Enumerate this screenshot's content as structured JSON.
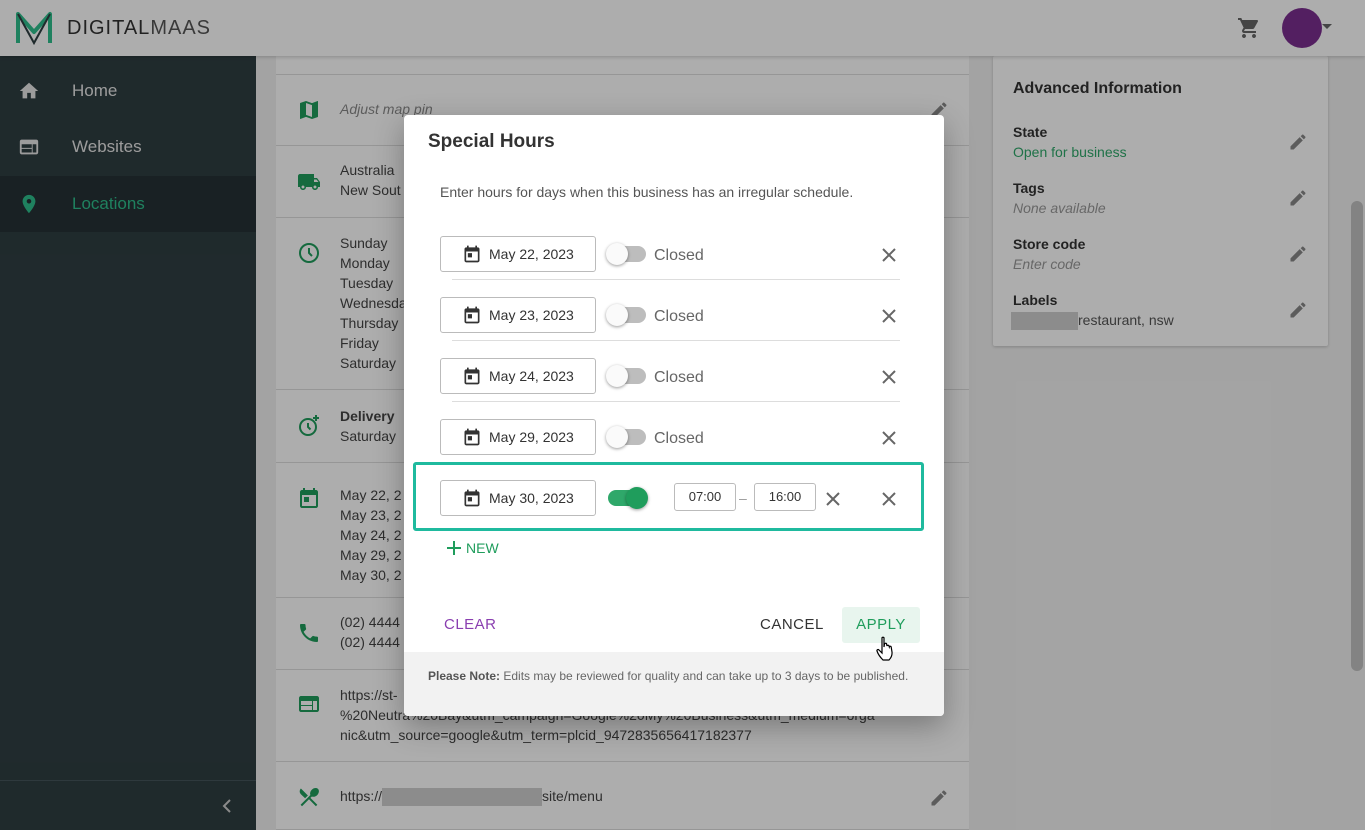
{
  "app": {
    "logo_bold": "DIGITAL",
    "logo_light": "MAAS",
    "brand_color": "#2fbf8c"
  },
  "sidebar": {
    "items": [
      {
        "label": "Home",
        "icon": "home-icon"
      },
      {
        "label": "Websites",
        "icon": "web-icon"
      },
      {
        "label": "Locations",
        "icon": "location-pin-icon"
      }
    ]
  },
  "main": {
    "map_pin": "Adjust map pin",
    "service_area_1": "Australia",
    "service_area_2": "New Sout",
    "days": [
      "Sunday",
      "Monday",
      "Tuesday",
      "Wednesday",
      "Thursday",
      "Friday",
      "Saturday"
    ],
    "delivery_label": "Delivery",
    "delivery_day": "Saturday",
    "special_dates": [
      "May 22, 2",
      "May 23, 2",
      "May 24, 2",
      "May 29, 2",
      "May 30, 2"
    ],
    "phones": [
      "(02) 4444",
      "(02) 4444"
    ],
    "url_line1": "https://st-",
    "url_line2": "%20Neutra%20Bay&utm_campaign=Google%20My%20Business&utm_medium=orga",
    "url_line3": "nic&utm_source=google&utm_term=plcid_9472835656417182377",
    "menu_prefix": "https://",
    "menu_suffix": "site/menu"
  },
  "advanced": {
    "title": "Advanced Information",
    "state_label": "State",
    "state_value": "Open for business",
    "tags_label": "Tags",
    "tags_value": "None available",
    "store_label": "Store code",
    "store_value": "Enter code",
    "labels_label": "Labels",
    "labels_value": "restaurant, nsw"
  },
  "dialog": {
    "title": "Special Hours",
    "subtitle": "Enter hours for days when this business has an irregular schedule.",
    "rows": [
      {
        "date": "May 22, 2023",
        "status": "Closed",
        "open": false
      },
      {
        "date": "May 23, 2023",
        "status": "Closed",
        "open": false
      },
      {
        "date": "May 24, 2023",
        "status": "Closed",
        "open": false
      },
      {
        "date": "May 29, 2023",
        "status": "Closed",
        "open": false
      },
      {
        "date": "May 30, 2023",
        "open": true,
        "from": "07:00",
        "to": "16:00"
      }
    ],
    "new_label": "NEW",
    "clear_label": "CLEAR",
    "cancel_label": "CANCEL",
    "apply_label": "APPLY",
    "note_bold": "Please Note:",
    "note_text": " Edits may be reviewed for quality and can take up to 3 days to be published."
  }
}
